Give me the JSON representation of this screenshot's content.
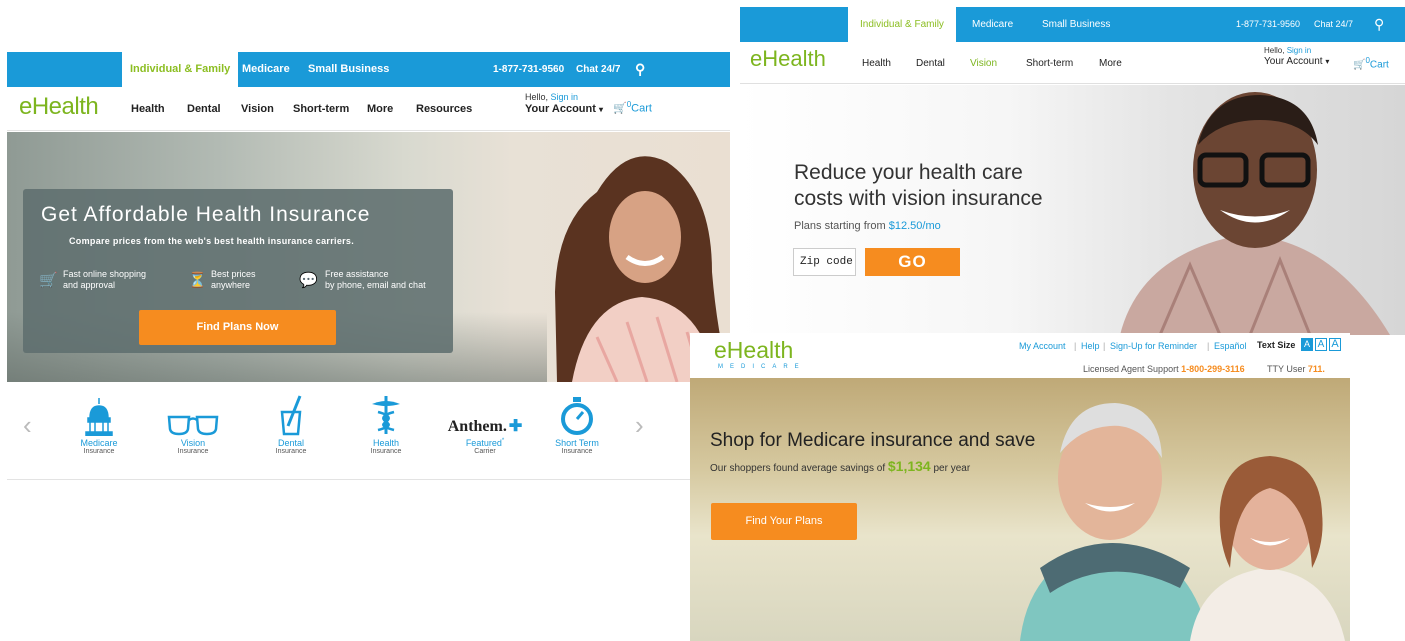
{
  "screen1": {
    "tabs": [
      "Individual & Family",
      "Medicare",
      "Small Business"
    ],
    "phone": "1-877-731-9560",
    "chat": "Chat 24/7",
    "logo": "eHealth",
    "nav": [
      "Health",
      "Dental",
      "Vision",
      "Short-term",
      "More",
      "Resources"
    ],
    "hello": "Hello,",
    "sign_in": "Sign in",
    "account": "Your Account",
    "cart_count": "0",
    "cart": "Cart",
    "headline": "Get Affordable Health Insurance",
    "subhead": "Compare prices from the web's best health insurance carriers.",
    "features": [
      {
        "line1": "Fast online shopping",
        "line2": "and approval",
        "icon": "cart-icon"
      },
      {
        "line1": "Best prices",
        "line2": "anywhere",
        "icon": "price-tag-icon"
      },
      {
        "line1": "Free assistance",
        "line2": "by phone, email and chat",
        "icon": "chat-bubble-icon"
      }
    ],
    "cta": "Find Plans Now",
    "categories": [
      {
        "line1": "Medicare",
        "line2": "Insurance",
        "icon": "capitol-icon"
      },
      {
        "line1": "Vision",
        "line2": "Insurance",
        "icon": "glasses-icon"
      },
      {
        "line1": "Dental",
        "line2": "Insurance",
        "icon": "toothbrush-cup-icon"
      },
      {
        "line1": "Health",
        "line2": "Insurance",
        "icon": "caduceus-icon"
      },
      {
        "line1": "Featured",
        "line1_sup": "*",
        "line2": "Carrier",
        "brand": "Anthem."
      },
      {
        "line1": "Short Term",
        "line2": "Insurance",
        "icon": "stopwatch-icon"
      }
    ],
    "colors": {
      "accent_blue": "#1a9ad8",
      "brand_green": "#7db51f",
      "cta_orange": "#f68c1f"
    }
  },
  "screen2": {
    "tabs": [
      "Individual & Family",
      "Medicare",
      "Small Business"
    ],
    "phone": "1-877-731-9560",
    "chat": "Chat 24/7",
    "logo": "eHealth",
    "nav": [
      "Health",
      "Dental",
      "Vision",
      "Short-term",
      "More"
    ],
    "hello": "Hello,",
    "sign_in": "Sign in",
    "account": "Your Account",
    "cart_count": "0",
    "cart": "Cart",
    "headline_line1": "Reduce your health care",
    "headline_line2": "costs with vision insurance",
    "starting_text": "Plans starting from",
    "starting_price": "$12.50/mo",
    "zip_placeholder": "Zip code",
    "go": "GO"
  },
  "screen3": {
    "logo": "eHealth",
    "logo_sub": "MEDICARE",
    "links": [
      "My Account",
      "Help",
      "Sign-Up for Reminder",
      "Español"
    ],
    "text_size_label": "Text Size",
    "text_size_options": [
      "A",
      "A",
      "A"
    ],
    "agent_label": "Licensed Agent Support",
    "agent_phone": "1-800-299-3116",
    "tty_label": "TTY User",
    "tty_num": "711.",
    "headline": "Shop for Medicare insurance and save",
    "savings_pre": "Our shoppers found average savings of",
    "savings_amount": "$1,134",
    "savings_post": "per year",
    "cta": "Find Your Plans"
  }
}
